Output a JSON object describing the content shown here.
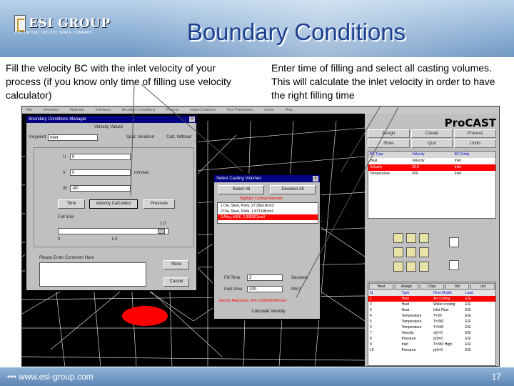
{
  "header": {
    "title": "Boundary Conditions",
    "logo_text": "ESI GROUP",
    "logo_subtext": "THE VIRTUAL TRY-OUT SPACE COMPANY"
  },
  "text_left": "Fill the velocity BC with the inlet velocity of your process (if you know only time of filling use velocity calculator)",
  "text_right": "Enter time of filling and select all casting volumes. This will calculate the inlet velocity in order to have the right filling time",
  "app": {
    "menu_items": [
      "File",
      "Geometry",
      "Materials",
      "Interfaces",
      "Boundary Conditions",
      "Process",
      "Initial Conditions",
      "Run Parameters",
      "Solver",
      "Help"
    ],
    "brand": "ProCAST",
    "toolbar_buttons": [
      "Assign",
      "Create",
      "Process",
      "Store",
      "Quit",
      "Undo"
    ],
    "bc_table": {
      "headers": [
        "BC Type",
        "Velocity",
        "BC Entity"
      ],
      "rows": [
        [
          "Heat",
          "Velocity",
          "Inlet"
        ],
        [
          "Velocity",
          "25.0",
          "Inlet"
        ],
        [
          "Temperature",
          "500",
          "Inlet"
        ]
      ],
      "selected_row": 1
    },
    "materials_tabs": [
      "Heat",
      "Assign",
      "Copy",
      "Del",
      "List"
    ],
    "materials_table": {
      "headers": [
        "Id",
        "Type",
        "Flow Model",
        "Load"
      ],
      "rows": [
        [
          "1",
          "Heat",
          "Air cooling",
          "ESI"
        ],
        [
          "2",
          "Heat",
          "Water cooling",
          "ESI"
        ],
        [
          "3",
          "Heat",
          "Inlet Flow",
          "ESI"
        ],
        [
          "4",
          "Temperature",
          "T=30",
          "ESI"
        ],
        [
          "5",
          "Temperature",
          "T=350",
          "ESI"
        ],
        [
          "6",
          "Temperature",
          "T=500",
          "ESI"
        ],
        [
          "7",
          "Velocity",
          "v(t)=0",
          "ESI"
        ],
        [
          "8",
          "Pressure",
          "p(t)=0",
          "ESI"
        ],
        [
          "9",
          "Inlet",
          "T=350 High",
          "ESI"
        ],
        [
          "10",
          "Pressure",
          "p(t)=0",
          "ESI"
        ]
      ],
      "selected_row": 0
    }
  },
  "bc_dialog": {
    "title": "Boundary Conditions Manager",
    "section": "Velocity Values",
    "keyword_label": "Keyword",
    "keyword_value": "Inlet",
    "spatial_label": "Spat. Variation",
    "cartesian_label": "Cart. Without",
    "vx_label": "U",
    "vy_label": "V",
    "vz_label": "W",
    "vx_value": "0",
    "vy_value": "0",
    "vz_value": "-80",
    "units": "mm/sec",
    "btn_time": "Time",
    "btn_calculator": "Velocity Calculator",
    "btn_pressure": "Pressure",
    "fill_label": "Full Inlet",
    "slider_max": "1.0",
    "slider_min": "0",
    "slider_mid": "1.0",
    "notes_label": "Please Enter Comment Here",
    "btn_store": "Store",
    "btn_cancel": "Cancel"
  },
  "cast_dialog": {
    "title": "Select Casting Volumes",
    "btn_select_all": "Select All",
    "btn_deselect_all": "Deselect All",
    "list_label": "Highlight Casting Materials",
    "volumes": [
      "1 Die, Steel, Parts, 27.36E1Bcm3",
      "2 Die, Steel, Parts, 1.87310Bcm3",
      "3 Alloy, A356, 2.8389E2cm3"
    ],
    "selected_volume": 2,
    "fill_time_label": "Fill Time",
    "fill_time_value": "2",
    "fill_time_unit": "Seconds",
    "inlet_area_label": "Inlet Area",
    "inlet_area_value": "100",
    "inlet_area_unit": "Mm2",
    "velocity_result": "Velocity Magnitude: 364.23396299 Mm/sec",
    "btn_calculate": "Calculate Velocity"
  },
  "footer": {
    "url": "www.esi-group.com",
    "page": "17"
  },
  "colors": {
    "title": "#1c3f8f",
    "selection": "#ff0000",
    "dialog_titlebar": "#000080"
  }
}
